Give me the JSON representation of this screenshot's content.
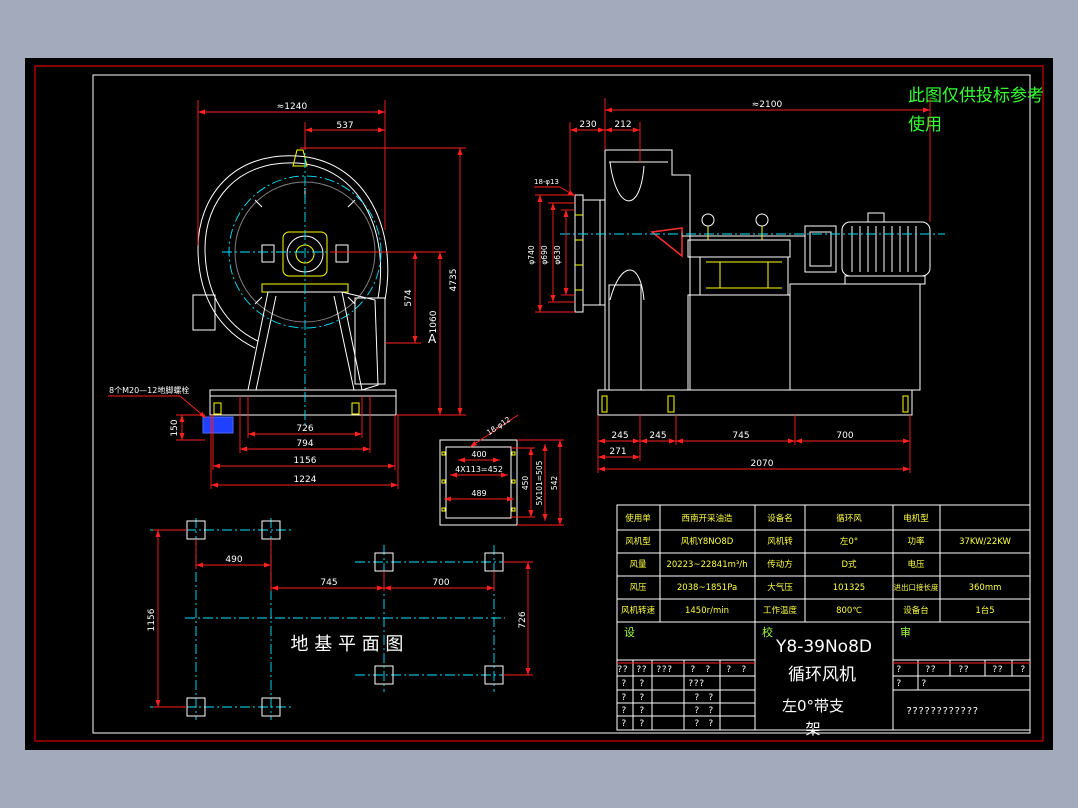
{
  "colors": {
    "viewer_background": "#a3aabb",
    "canvas": "#000000",
    "border": "#ff0000",
    "frame": "#ffffff",
    "dimension": "#ff2020",
    "centerline": "#00e5ff",
    "note": "#33ff33",
    "table_text": "#ffff40"
  },
  "note": {
    "line1": "此图仅供投标参考",
    "line2": "使用"
  },
  "front_view": {
    "dims": {
      "width_total": "≈1240",
      "half_width": "537",
      "height": "4735",
      "shaft_height": "574",
      "outlet_height": "1060",
      "section": "A",
      "bolt_inner": "726",
      "bolt_outer": "794",
      "base_inner": "1156",
      "base_outer": "1224",
      "base_height": "150"
    },
    "bolts_label": "8个M20—12地脚螺栓"
  },
  "side_view": {
    "dims": {
      "length_total": "≈2100",
      "inlet_offset": "230",
      "inlet_depth": "212",
      "flange_holes": "18-φ13",
      "d1": "φ740",
      "d2": "φ690",
      "d3": "φ630",
      "b1": "245",
      "b2": "245",
      "b3": "745",
      "b4": "700",
      "b5": "271",
      "base_length": "2070"
    }
  },
  "outlet_detail": {
    "holes": "18-φ12",
    "w_inner": "400",
    "w_bolt": "4X113=452",
    "w_outer": "489",
    "h_inner": "450",
    "h_bolt": "5X101=505",
    "h_outer": "542"
  },
  "foundation_plan": {
    "title": "地 基 平 面 图",
    "dims": {
      "a": "490",
      "b": "745",
      "c": "700",
      "length": "1156",
      "width": "726"
    }
  },
  "title_block": {
    "rows": [
      [
        "使用单",
        "西南开采油造",
        "设备名",
        "循环风",
        "电机型"
      ],
      [
        "风机型",
        "风机Y8NO8D",
        "风机转",
        "左0°",
        "功率",
        "37KW/22KW"
      ],
      [
        "风量",
        "20223~22841m³/h",
        "传动方",
        "D式",
        "电压"
      ],
      [
        "风压",
        "2038~1851Pa",
        "大气压",
        "101325",
        "进出口接长度",
        "360mm"
      ],
      [
        "风机转速",
        "1450r/min",
        "工作温度",
        "800℃",
        "设备台",
        "1台5"
      ]
    ],
    "labels": {
      "design": "设",
      "check": "校",
      "approve": "审"
    },
    "model": "Y8-39No8D",
    "name": "循环风机",
    "variant_1": "左0°带支",
    "variant_2": "架",
    "grid_left": [
      [
        "??",
        "??",
        "???",
        "?",
        "?",
        "?",
        "?"
      ],
      [
        "?",
        "?",
        "???"
      ],
      [
        "?",
        "?",
        "?",
        "?"
      ],
      [
        "?",
        "?",
        "?",
        "?"
      ],
      [
        "?",
        "?",
        "?",
        "?"
      ]
    ],
    "grid_right": [
      [
        "?",
        "??",
        "??",
        "??",
        "?"
      ],
      [
        "?",
        "?"
      ]
    ],
    "drawing_no": "????????????"
  }
}
